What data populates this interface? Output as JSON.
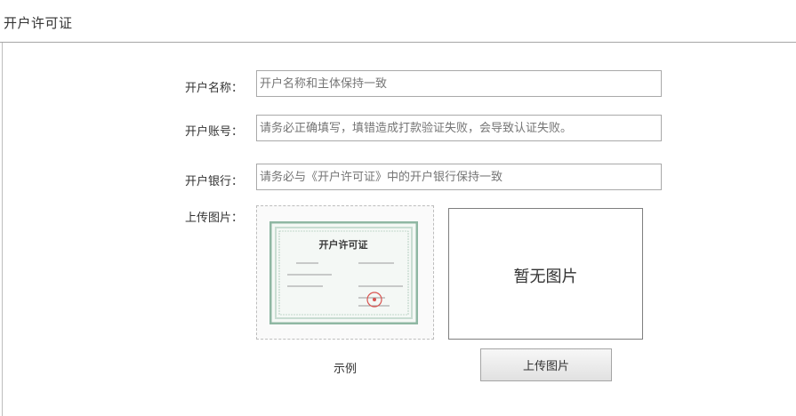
{
  "header": {
    "title": "开户许可证"
  },
  "form": {
    "account_name": {
      "label": "开户名称：",
      "placeholder": "开户名称和主体保持一致"
    },
    "account_number": {
      "label": "开户账号：",
      "placeholder": "请务必正确填写，填错造成打款验证失败，会导致认证失败。"
    },
    "bank": {
      "label": "开户银行：",
      "placeholder": "请务必与《开户许可证》中的开户银行保持一致"
    },
    "upload": {
      "label": "上传图片：",
      "sample_caption": "示例",
      "preview_empty_text": "暂无图片",
      "button_label": "上传图片"
    }
  },
  "sample_certificate": {
    "title": "开户许可证",
    "colors": {
      "border": "#8fb7a3",
      "inner": "#c9ddd2",
      "stamp": "#d9534f",
      "text": "#555555"
    }
  }
}
